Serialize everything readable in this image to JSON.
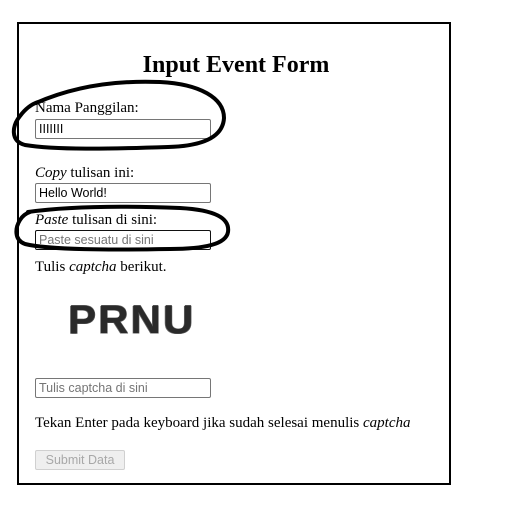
{
  "form": {
    "title": "Input Event Form",
    "nama": {
      "label": "Nama Panggilan:",
      "value": "IIIIIII"
    },
    "copy": {
      "label_em": "Copy",
      "label_rest": " tulisan ini:",
      "value": "Hello World!"
    },
    "paste": {
      "label_em": "Paste",
      "label_rest": " tulisan di sini:",
      "placeholder": "Paste sesuatu di sini"
    },
    "captcha": {
      "instruction_pre": "Tulis ",
      "instruction_em": "captcha",
      "instruction_post": " berikut.",
      "image_text": "PRNU",
      "placeholder": "Tulis captcha di sini"
    },
    "hint": {
      "pre": "Tekan Enter pada keyboard jika sudah selesai menulis ",
      "em": "captcha"
    },
    "submit_label": "Submit Data"
  },
  "annotations": {
    "marker_color": "#000000"
  }
}
